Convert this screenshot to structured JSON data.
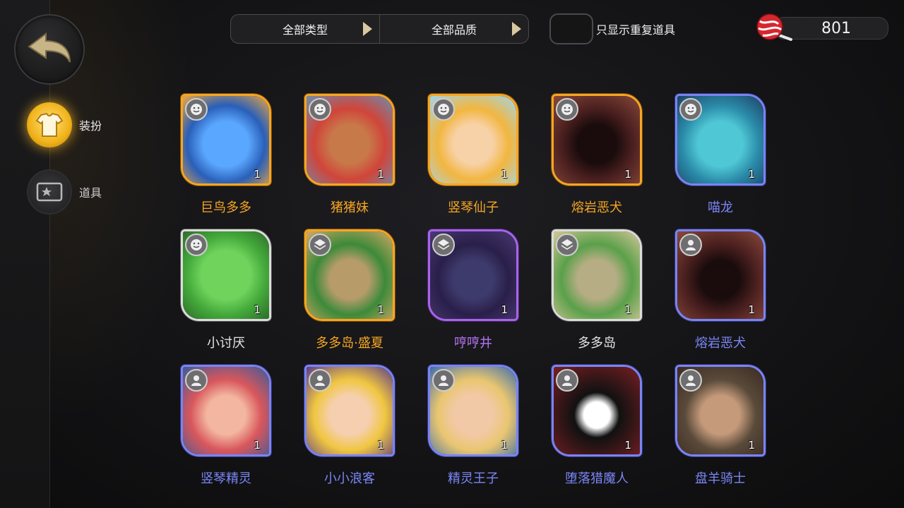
{
  "filters": {
    "type_label": "全部类型",
    "quality_label": "全部品质"
  },
  "toggle": {
    "label": "只显示重复道具",
    "checked": false
  },
  "currency": {
    "value": "801",
    "icon": "candy-icon"
  },
  "sidebar": {
    "items": [
      {
        "label": "装扮",
        "icon": "shirt-icon",
        "active": true
      },
      {
        "label": "道具",
        "icon": "prop-ticket-icon",
        "active": false
      }
    ]
  },
  "colors": {
    "orange": "#f6a623",
    "white": "#e4e4e4",
    "purple": "#b574f4",
    "blue": "#7b86f6"
  },
  "items": [
    {
      "name": "巨鸟多多",
      "qty": "1",
      "rarity": "orange",
      "badge": "face-icon",
      "art": "bird"
    },
    {
      "name": "猪猪妹",
      "qty": "1",
      "rarity": "orange",
      "badge": "face-icon",
      "art": "girl-red"
    },
    {
      "name": "竖琴仙子",
      "qty": "1",
      "rarity": "orange",
      "badge": "face-icon",
      "art": "angel"
    },
    {
      "name": "熔岩恶犬",
      "qty": "1",
      "rarity": "orange",
      "badge": "face-icon",
      "art": "lava"
    },
    {
      "name": "喵龙",
      "qty": "1",
      "rarity": "blue",
      "badge": "face-icon",
      "art": "dragon"
    },
    {
      "name": "小讨厌",
      "qty": "1",
      "rarity": "white",
      "badge": "face-icon",
      "art": "green"
    },
    {
      "name": "多多岛·盛夏",
      "qty": "1",
      "rarity": "orange",
      "badge": "board-icon",
      "art": "island-summer"
    },
    {
      "name": "哼哼井",
      "qty": "1",
      "rarity": "purple",
      "badge": "board-icon",
      "art": "well"
    },
    {
      "name": "多多岛",
      "qty": "1",
      "rarity": "white",
      "badge": "board-icon",
      "art": "island"
    },
    {
      "name": "熔岩恶犬",
      "qty": "1",
      "rarity": "blue",
      "badge": "avatar-icon",
      "art": "lava"
    },
    {
      "name": "竖琴精灵",
      "qty": "1",
      "rarity": "blue",
      "badge": "avatar-icon",
      "art": "goggles"
    },
    {
      "name": "小小浪客",
      "qty": "1",
      "rarity": "blue",
      "badge": "avatar-icon",
      "art": "blonde"
    },
    {
      "name": "精灵王子",
      "qty": "1",
      "rarity": "blue",
      "badge": "avatar-icon",
      "art": "elf"
    },
    {
      "name": "堕落猎魔人",
      "qty": "1",
      "rarity": "blue",
      "badge": "avatar-icon",
      "art": "demon"
    },
    {
      "name": "盘羊骑士",
      "qty": "1",
      "rarity": "blue",
      "badge": "avatar-icon",
      "art": "ram"
    }
  ]
}
